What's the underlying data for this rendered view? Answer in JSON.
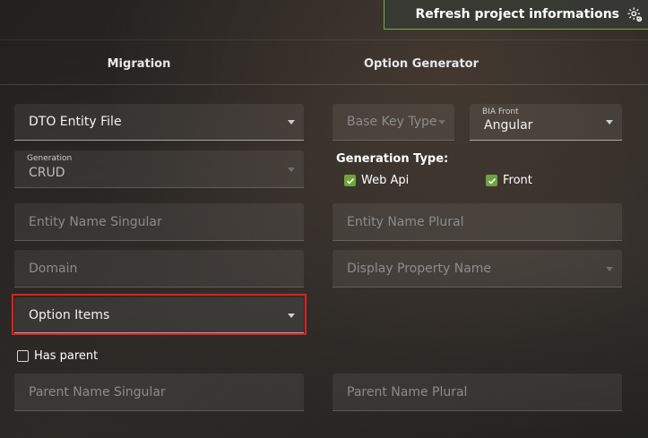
{
  "header": {
    "refresh_label": "Refresh project informations"
  },
  "tabs": [
    "Migration",
    "Option Generator"
  ],
  "form": {
    "dto_entity_file": "DTO Entity File",
    "generation_label": "Generation",
    "generation_value": "CRUD",
    "entity_name_singular": "Entity Name Singular",
    "domain": "Domain",
    "option_items": "Option Items",
    "has_parent": "Has parent",
    "parent_name_singular": "Parent Name Singular",
    "base_key_type": "Base Key Type",
    "bia_front_label": "BIA Front",
    "bia_front_value": "Angular",
    "generation_type_label": "Generation Type:",
    "web_api_label": "Web Api",
    "front_label": "Front",
    "entity_name_plural": "Entity Name Plural",
    "display_property_name": "Display Property Name",
    "parent_name_plural": "Parent Name Plural"
  },
  "colors": {
    "accent_green": "#6ea33f",
    "highlight_red": "#e02020"
  }
}
